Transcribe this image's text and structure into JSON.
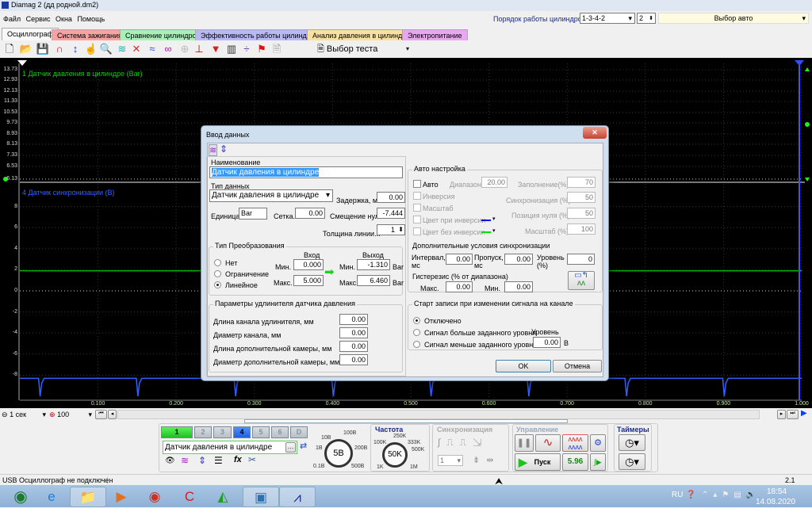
{
  "window": {
    "title": "Diamag 2 (дд родной.dm2)"
  },
  "menu": [
    "Файл",
    "Сервис",
    "Окна",
    "Помощь"
  ],
  "cylinder_order": {
    "label": "Порядок работы цилиндров",
    "value": "1-3-4-2",
    "spin": "2",
    "auto_select": "Выбор авто"
  },
  "tabs": [
    {
      "label": "Осциллограф",
      "color": "#f0f0f0",
      "active": true
    },
    {
      "label": "Система зажигания",
      "color": "#f5a3a3"
    },
    {
      "label": "Сравнение цилиндров",
      "color": "#a8f0b8"
    },
    {
      "label": "Эффективность работы цилиндров",
      "color": "#b8b8f5"
    },
    {
      "label": "Анализ давления в цилиндре",
      "color": "#f8e0a0"
    },
    {
      "label": "Электропитание",
      "color": "#e8a8f0"
    }
  ],
  "toolbar": {
    "icons": [
      "new-file",
      "open-folder",
      "save",
      "zoom-horizontal",
      "zoom-vertical",
      "hand",
      "magnifier",
      "fit",
      "cursor-x",
      "waves",
      "lissajous",
      "auto",
      "zero",
      "filter",
      "table",
      "separator-line",
      "flag",
      "document"
    ],
    "test_select": "Выбор теста"
  },
  "scope": {
    "ch1": {
      "label": "1 Датчик давления в цилиндре (Bar)",
      "color": "#00d000",
      "yticks": [
        "13.73",
        "12.93",
        "12.13",
        "11.33",
        "10.53",
        "9.73",
        "8.93",
        "8.13",
        "7.33",
        "6.53",
        "6.13"
      ]
    },
    "ch4": {
      "label": "4 Датчик синхронизации (В)",
      "color": "#3060ff",
      "yticks": [
        "8",
        "6",
        "4",
        "2",
        "0",
        "-2",
        "-4",
        "-6",
        "-8"
      ],
      "baseline_v": -8.3,
      "dip_v": -10,
      "dip_times_s": [
        0.026,
        0.151,
        0.276,
        0.401,
        0.526,
        0.651,
        0.776,
        0.901
      ]
    },
    "green_level_v": 1.9,
    "xticks": [
      "0.100",
      "0.200",
      "0.300",
      "0.400",
      "0.500",
      "0.600",
      "0.700",
      "0.800",
      "0.900",
      "1.000"
    ],
    "time_scale": "1 сек",
    "zoom": "100"
  },
  "dialog": {
    "title": "Ввод данных",
    "name_label": "Наименование",
    "name_value": "Датчик давления в цилиндре",
    "type_label": "Тип данных",
    "type_value": "Датчик давления в цилиндре",
    "delay_label": "Задержка, мс",
    "delay_value": "0.00",
    "unit_label": "Единица..",
    "unit_value": "Bar",
    "grid_label": "Сетка..",
    "grid_value": "0.00",
    "offset_label": "Смещение нуля",
    "offset_value": "-7.444",
    "width_label": "Толщина линии...",
    "width_value": "1",
    "conv": {
      "title": "Тип Преобразования",
      "options": [
        "Нет",
        "Ограничение",
        "Линейное"
      ],
      "selected": "Линейное",
      "in_label": "Вход",
      "out_label": "Выход",
      "min_label": "Мин.",
      "max_label": "Макс.",
      "in_min": "0.000",
      "in_max": "5.000",
      "out_min": "-1.310",
      "out_max": "6.460",
      "unit": "Bar"
    },
    "ext": {
      "title": "Параметры удлинителя датчика давления",
      "rows": [
        {
          "label": "Длина канала удлинителя, мм",
          "value": "0.00"
        },
        {
          "label": "Диаметр канала, мм",
          "value": "0.00"
        },
        {
          "label": "Длина дополнительной камеры, мм",
          "value": "0.00"
        },
        {
          "label": "Диаметр дополнительной камеры, мм",
          "value": "0.00"
        }
      ]
    },
    "auto": {
      "title": "Авто настройка",
      "auto": "Авто",
      "range_label": "Диапазон.",
      "range_value": "20.00",
      "inversion": "Инверсия",
      "scale": "Масштаб",
      "color_inv": "Цвет при инверсии",
      "color_noinv": "Цвет без инверсии",
      "color_inv_hex": "#0000ff",
      "color_noinv_hex": "#00e000",
      "fill_label": "Заполнение(%)",
      "fill_value": "70",
      "sync_label": "Синхронизация (%)",
      "sync_value": "50",
      "zero_label": "Позиция нуля (%)",
      "zero_value": "50",
      "scale_label": "Масштаб (%)",
      "scale_value": "100",
      "extra_title": "Дополнительные условия синхронизации",
      "interval_label": "Интервал, мс",
      "interval_value": "0.00",
      "skip_label": "Пропуск, мс",
      "skip_value": "0.00",
      "level_label": "Уровень (%)",
      "level_value": "0",
      "hyst_label": "Гистерезис (% от диапазона)",
      "max_label": "Макс.",
      "max_value": "0.00",
      "min_label": "Мин.",
      "min_value": "0.00"
    },
    "start": {
      "title": "Старт записи при изменении сигнала на канале",
      "options": [
        "Отключено",
        "Сигнал больше заданного уровня",
        "Сигнал меньше заданного уровня"
      ],
      "selected": "Отключено",
      "level_label": "Уровень",
      "level_value": "0.00",
      "unit": "В"
    },
    "ok": "OK",
    "cancel": "Отмена"
  },
  "bottom": {
    "channels": [
      "1",
      "2",
      "3",
      "4",
      "5",
      "6",
      "D"
    ],
    "channel_name": "Датчик давления в цилиндре",
    "volt_knob": {
      "value": "5В",
      "labels": [
        "10В",
        "100В",
        "1В",
        "200В",
        "0.1В",
        "500В"
      ]
    },
    "freq": {
      "title": "Частота",
      "value": "50K",
      "labels": [
        "250K",
        "100K",
        "333K",
        "500K",
        "1K",
        "1M"
      ]
    },
    "sync": {
      "title": "Синхронизация",
      "select": "1"
    },
    "control": {
      "title": "Управление",
      "start": "Пуск",
      "value": "5.96"
    },
    "timers": {
      "title": "Таймеры"
    }
  },
  "status": {
    "left": "USB Осциллограф не подключен",
    "right": "2.1"
  },
  "taskbar": {
    "lang": "RU",
    "time": "18:54",
    "date": "14.08.2020"
  }
}
